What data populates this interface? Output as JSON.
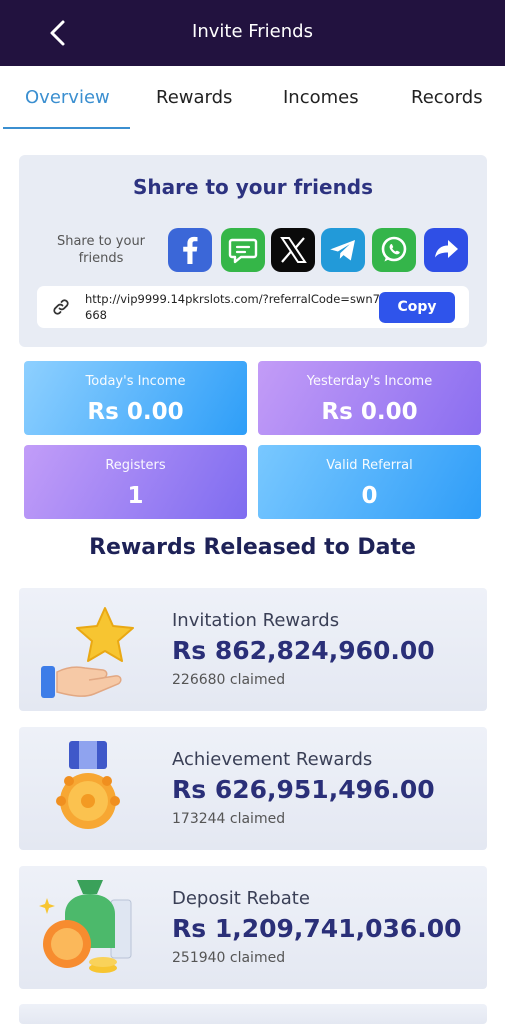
{
  "header": {
    "title": "Invite Friends"
  },
  "tabs": [
    {
      "label": "Overview"
    },
    {
      "label": "Rewards"
    },
    {
      "label": "Incomes"
    },
    {
      "label": "Records"
    }
  ],
  "share": {
    "title": "Share to your friends",
    "label": "Share to your friends",
    "icons": [
      "facebook-icon",
      "message-icon",
      "x-icon",
      "telegram-icon",
      "whatsapp-icon",
      "share-arrow-icon"
    ],
    "link": "http://vip9999.14pkrslots.com/?referralCode=swn7668",
    "copy_label": "Copy"
  },
  "stats": [
    {
      "label": "Today's Income",
      "value": "Rs 0.00"
    },
    {
      "label": "Yesterday's Income",
      "value": "Rs 0.00"
    },
    {
      "label": "Registers",
      "value": "1"
    },
    {
      "label": "Valid Referral",
      "value": "0"
    }
  ],
  "rewards_section": {
    "title": "Rewards Released to Date"
  },
  "rewards": [
    {
      "name": "Invitation Rewards",
      "amount": "Rs 862,824,960.00",
      "claimed": "226680 claimed",
      "icon": "star-hand-icon"
    },
    {
      "name": "Achievement Rewards",
      "amount": "Rs 626,951,496.00",
      "claimed": "173244 claimed",
      "icon": "medal-icon"
    },
    {
      "name": "Deposit Rebate",
      "amount": "Rs 1,209,741,036.00",
      "claimed": "251940 claimed",
      "icon": "money-bag-icon"
    }
  ],
  "colors": {
    "header_bg": "#22123f",
    "accent": "#3b8fd0",
    "copy_button": "#2f54eb",
    "title_navy": "#2d3380"
  }
}
